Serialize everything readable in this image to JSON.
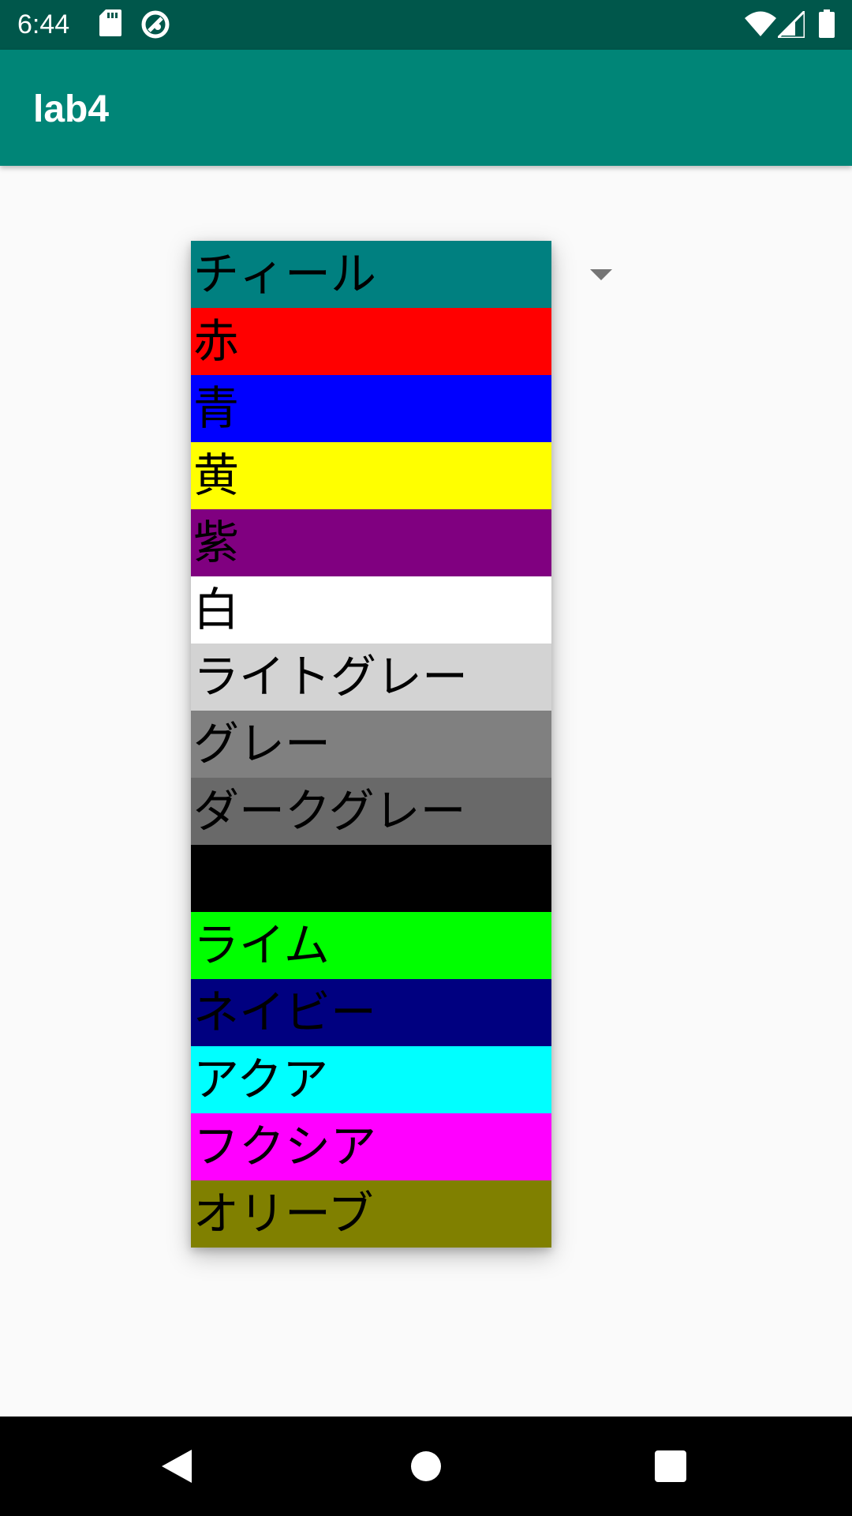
{
  "status_bar": {
    "time": "6:44",
    "icons": [
      "sd-card-icon",
      "do-not-disturb-icon",
      "wifi-icon",
      "cellular-signal-icon",
      "battery-icon"
    ]
  },
  "app_bar": {
    "title": "lab4"
  },
  "spinner": {
    "arrow_icon": "chevron-down-icon",
    "options": [
      {
        "label": "チィール",
        "bg": "#008080"
      },
      {
        "label": "赤",
        "bg": "#ff0000"
      },
      {
        "label": "青",
        "bg": "#0000ff"
      },
      {
        "label": "黄",
        "bg": "#ffff00"
      },
      {
        "label": "紫",
        "bg": "#800080"
      },
      {
        "label": "白",
        "bg": "#ffffff"
      },
      {
        "label": "ライトグレー",
        "bg": "#d3d3d3"
      },
      {
        "label": "グレー",
        "bg": "#808080"
      },
      {
        "label": "ダークグレー",
        "bg": "#696969"
      },
      {
        "label": "",
        "bg": "#000000"
      },
      {
        "label": "ライム",
        "bg": "#00ff00"
      },
      {
        "label": "ネイビー",
        "bg": "#000080"
      },
      {
        "label": "アクア",
        "bg": "#00ffff"
      },
      {
        "label": "フクシア",
        "bg": "#ff00ff"
      },
      {
        "label": "オリーブ",
        "bg": "#808000"
      }
    ]
  },
  "nav_bar": {
    "buttons": [
      "back-icon",
      "home-icon",
      "recents-icon"
    ]
  }
}
